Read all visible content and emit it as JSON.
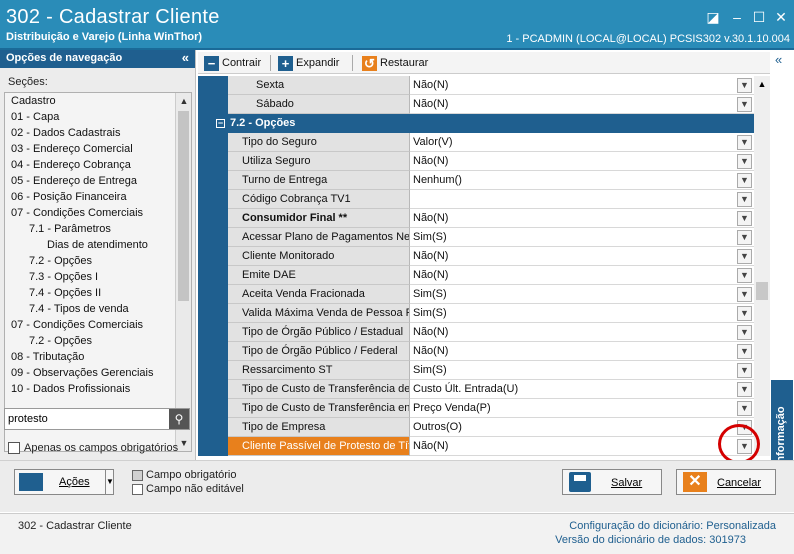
{
  "window": {
    "title": "302 - Cadastrar Cliente",
    "subtitle": "Distribuição e Varejo (Linha WinThor)",
    "session_info": "1 - PCADMIN (LOCAL@LOCAL)   PCSIS302  v.30.1.10.004"
  },
  "nav": {
    "header": "Opções de navegação",
    "sections_label": "Seções:",
    "items": [
      {
        "label": "Cadastro",
        "indent": 0
      },
      {
        "label": "01 - Capa",
        "indent": 0
      },
      {
        "label": "02 - Dados Cadastrais",
        "indent": 0
      },
      {
        "label": "03 - Endereço Comercial",
        "indent": 0
      },
      {
        "label": "04 - Endereço Cobrança",
        "indent": 0
      },
      {
        "label": "05 - Endereço de Entrega",
        "indent": 0
      },
      {
        "label": "06 - Posição Financeira",
        "indent": 0
      },
      {
        "label": "07 - Condições Comerciais",
        "indent": 0
      },
      {
        "label": "7.1 - Parâmetros",
        "indent": 1
      },
      {
        "label": "Dias de atendimento",
        "indent": 2
      },
      {
        "label": "7.2 - Opções",
        "indent": 1
      },
      {
        "label": "7.3 - Opções I",
        "indent": 1
      },
      {
        "label": "7.4 - Opções II",
        "indent": 1
      },
      {
        "label": "7.4 - Tipos de venda",
        "indent": 1
      },
      {
        "label": "07 - Condições Comerciais",
        "indent": 0
      },
      {
        "label": "7.2 - Opções",
        "indent": 1
      },
      {
        "label": "08 - Tributação",
        "indent": 0
      },
      {
        "label": "09 - Observações Gerenciais",
        "indent": 0
      },
      {
        "label": "10 - Dados Profissionais",
        "indent": 0
      }
    ],
    "search_value": "protesto",
    "required_only_label": "Apenas os campos obrigatórios"
  },
  "toolbar": {
    "collapse_label": "Contrair",
    "expand_label": "Expandir",
    "restore_label": "Restaurar"
  },
  "grid": {
    "top_rows": [
      {
        "label": "Sexta",
        "value": "Não(N)"
      },
      {
        "label": "Sábado",
        "value": "Não(N)"
      }
    ],
    "section_title": "7.2 - Opções",
    "rows": [
      {
        "label": "Tipo do Seguro",
        "value": "Valor(V)",
        "bold": false
      },
      {
        "label": "Utiliza Seguro",
        "value": "Não(N)",
        "bold": false
      },
      {
        "label": "Turno de Entrega",
        "value": "Nenhum()",
        "bold": false
      },
      {
        "label": "Código Cobrança TV1",
        "value": "",
        "bold": false
      },
      {
        "label": "Consumidor Final **",
        "value": "Não(N)",
        "bold": true
      },
      {
        "label": "Acessar Plano de Pagamentos Neg",
        "value": "Sim(S)",
        "bold": false
      },
      {
        "label": "Cliente Monitorado",
        "value": "Não(N)",
        "bold": false
      },
      {
        "label": "Emite DAE",
        "value": "Não(N)",
        "bold": false
      },
      {
        "label": "Aceita Venda Fracionada",
        "value": "Sim(S)",
        "bold": false
      },
      {
        "label": "Valida Máxima Venda de Pessoa Fí",
        "value": "Sim(S)",
        "bold": false
      },
      {
        "label": "Tipo de Órgão Público / Estadual",
        "value": "Não(N)",
        "bold": false
      },
      {
        "label": "Tipo de Órgão Público / Federal",
        "value": "Não(N)",
        "bold": false
      },
      {
        "label": "Ressarcimento ST",
        "value": "Sim(S)",
        "bold": false
      },
      {
        "label": "Tipo de Custo de Transferência de",
        "value": "Custo Últ. Entrada(U)",
        "bold": false
      },
      {
        "label": "Tipo de Custo de Transferência en",
        "value": "Preço Venda(P)",
        "bold": false
      },
      {
        "label": "Tipo de Empresa",
        "value": "Outros(O)",
        "bold": false
      },
      {
        "label": "Cliente Passível de Protesto de Títi",
        "value": "Não(N)",
        "bold": false,
        "highlight": true
      }
    ]
  },
  "side_tab": "Informação",
  "bottom": {
    "actions_label": "Ações",
    "legend_required": "Campo obrigatório",
    "legend_readonly": "Campo não editável",
    "save_label": "Salvar",
    "cancel_label": "Cancelar"
  },
  "status": {
    "left": "302 - Cadastrar Cliente",
    "dict_config_label": "Configuração do dicionário:",
    "dict_config_value": "Personalizada",
    "dict_version_label": "Versão do dicionário de dados:",
    "dict_version_value": "301973"
  },
  "colors": {
    "title_bar": "#2a8cb8",
    "accent": "#1f5f8f",
    "highlight": "#e8801c",
    "annotation_circle": "#d40000"
  }
}
